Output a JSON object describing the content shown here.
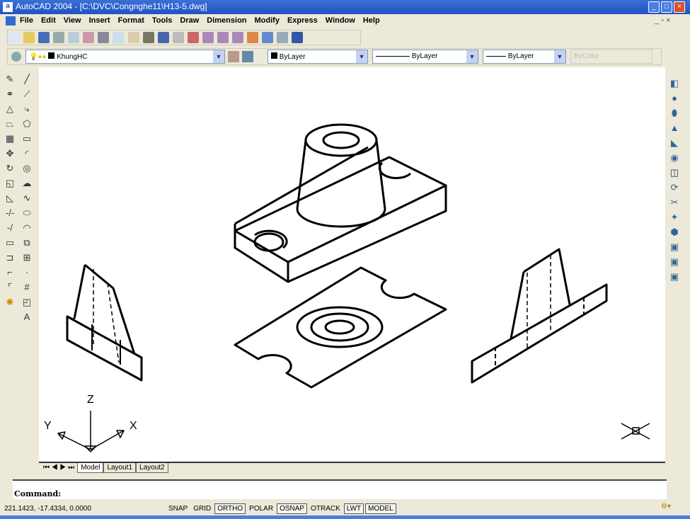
{
  "title": "AutoCAD 2004 - [C:\\DVC\\Congnghe11\\H13-5.dwg]",
  "menu": [
    "File",
    "Edit",
    "View",
    "Insert",
    "Format",
    "Tools",
    "Draw",
    "Dimension",
    "Modify",
    "Express",
    "Window",
    "Help"
  ],
  "properties": {
    "layer": "KhungHC",
    "color": "ByLayer",
    "linetype": "ByLayer",
    "lineweight": "ByLayer",
    "plotstyle": "ByColor"
  },
  "left_toolbar_last": "A",
  "ucs": {
    "x": "X",
    "y": "Y",
    "z": "Z"
  },
  "tabs": [
    "Model",
    "Layout1",
    "Layout2"
  ],
  "command": {
    "prompt": "Command:"
  },
  "status": {
    "coords": "221.1423, -17.4334, 0.0000",
    "toggles": [
      {
        "label": "SNAP",
        "on": false
      },
      {
        "label": "GRID",
        "on": false
      },
      {
        "label": "ORTHO",
        "on": true
      },
      {
        "label": "POLAR",
        "on": false
      },
      {
        "label": "OSNAP",
        "on": true
      },
      {
        "label": "OTRACK",
        "on": false
      },
      {
        "label": "LWT",
        "on": true
      },
      {
        "label": "MODEL",
        "on": true
      }
    ]
  }
}
